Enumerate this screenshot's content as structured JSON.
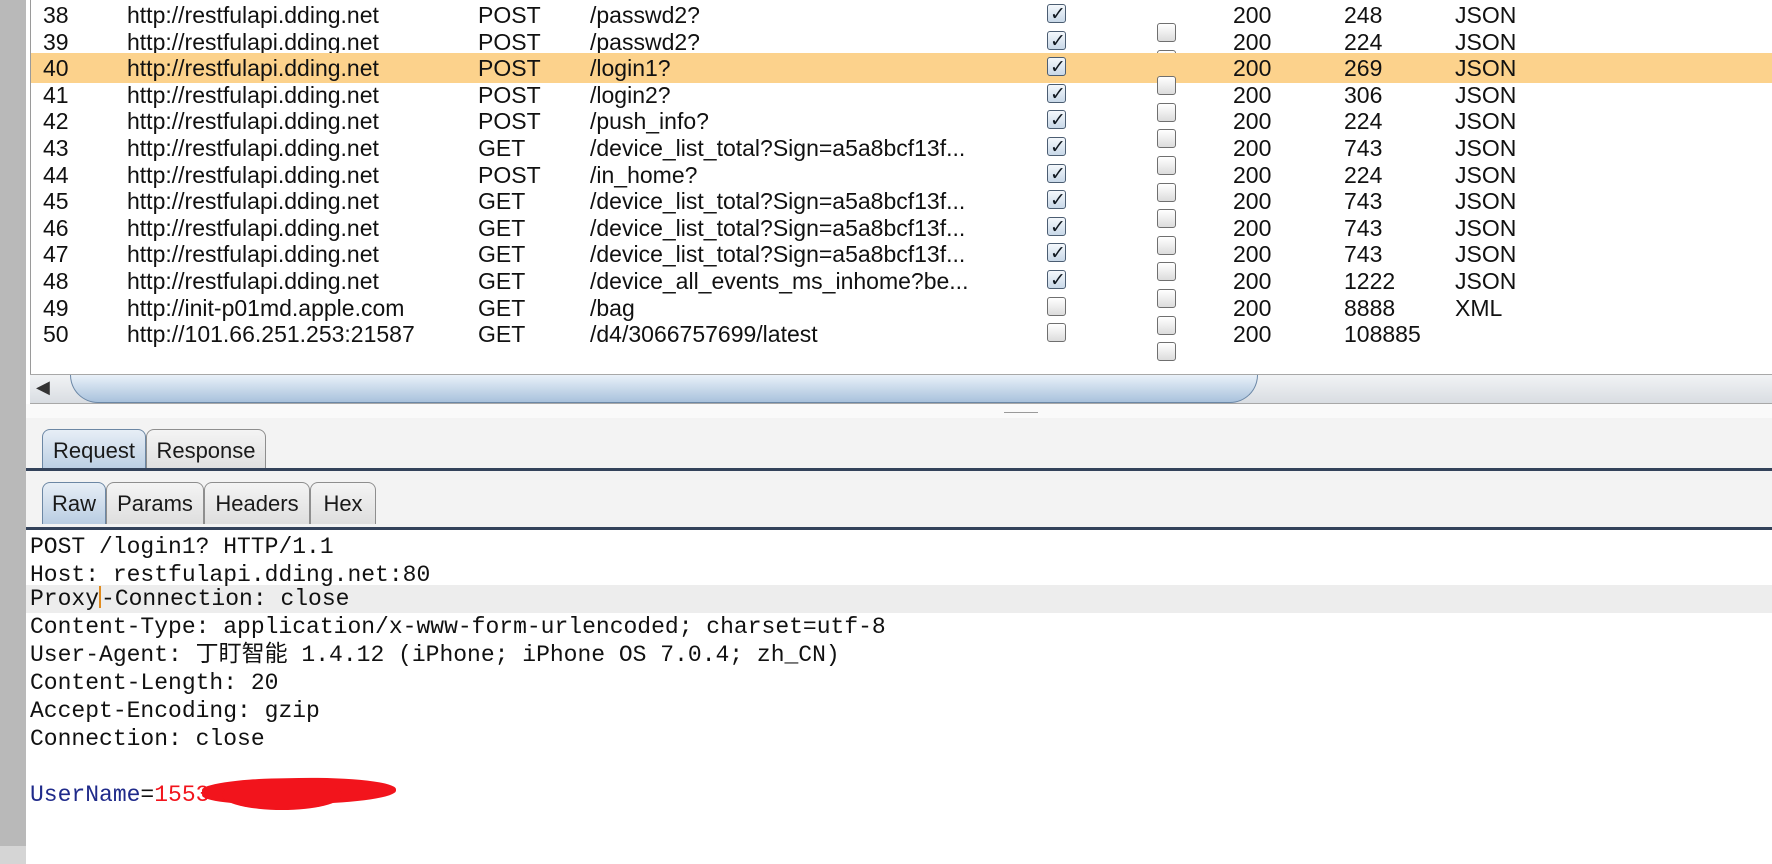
{
  "table": {
    "rows": [
      {
        "num": "38",
        "host": "http://restfulapi.dding.net",
        "method": "POST",
        "url": "/passwd2?",
        "params": true,
        "edited": false,
        "status": "200",
        "length": "248",
        "mime": "JSON",
        "selected": false
      },
      {
        "num": "39",
        "host": "http://restfulapi.dding.net",
        "method": "POST",
        "url": "/passwd2?",
        "params": true,
        "edited": false,
        "status": "200",
        "length": "224",
        "mime": "JSON",
        "selected": false
      },
      {
        "num": "40",
        "host": "http://restfulapi.dding.net",
        "method": "POST",
        "url": "/login1?",
        "params": true,
        "edited": false,
        "status": "200",
        "length": "269",
        "mime": "JSON",
        "selected": true
      },
      {
        "num": "41",
        "host": "http://restfulapi.dding.net",
        "method": "POST",
        "url": "/login2?",
        "params": true,
        "edited": false,
        "status": "200",
        "length": "306",
        "mime": "JSON",
        "selected": false
      },
      {
        "num": "42",
        "host": "http://restfulapi.dding.net",
        "method": "POST",
        "url": "/push_info?",
        "params": true,
        "edited": false,
        "status": "200",
        "length": "224",
        "mime": "JSON",
        "selected": false
      },
      {
        "num": "43",
        "host": "http://restfulapi.dding.net",
        "method": "GET",
        "url": "/device_list_total?Sign=a5a8bcf13f...",
        "params": true,
        "edited": false,
        "status": "200",
        "length": "743",
        "mime": "JSON",
        "selected": false
      },
      {
        "num": "44",
        "host": "http://restfulapi.dding.net",
        "method": "POST",
        "url": "/in_home?",
        "params": true,
        "edited": false,
        "status": "200",
        "length": "224",
        "mime": "JSON",
        "selected": false
      },
      {
        "num": "45",
        "host": "http://restfulapi.dding.net",
        "method": "GET",
        "url": "/device_list_total?Sign=a5a8bcf13f...",
        "params": true,
        "edited": false,
        "status": "200",
        "length": "743",
        "mime": "JSON",
        "selected": false
      },
      {
        "num": "46",
        "host": "http://restfulapi.dding.net",
        "method": "GET",
        "url": "/device_list_total?Sign=a5a8bcf13f...",
        "params": true,
        "edited": false,
        "status": "200",
        "length": "743",
        "mime": "JSON",
        "selected": false
      },
      {
        "num": "47",
        "host": "http://restfulapi.dding.net",
        "method": "GET",
        "url": "/device_list_total?Sign=a5a8bcf13f...",
        "params": true,
        "edited": false,
        "status": "200",
        "length": "743",
        "mime": "JSON",
        "selected": false
      },
      {
        "num": "48",
        "host": "http://restfulapi.dding.net",
        "method": "GET",
        "url": "/device_all_events_ms_inhome?be...",
        "params": true,
        "edited": false,
        "status": "200",
        "length": "1222",
        "mime": "JSON",
        "selected": false
      },
      {
        "num": "49",
        "host": "http://init-p01md.apple.com",
        "method": "GET",
        "url": "/bag",
        "params": false,
        "edited": false,
        "status": "200",
        "length": "8888",
        "mime": "XML",
        "selected": false
      },
      {
        "num": "50",
        "host": "http://101.66.251.253:21587",
        "method": "GET",
        "url": "/d4/3066757699/latest",
        "params": false,
        "edited": false,
        "status": "200",
        "length": "108885",
        "mime": "",
        "selected": false
      }
    ]
  },
  "tabs": {
    "request": "Request",
    "response": "Response"
  },
  "subtabs": {
    "raw": "Raw",
    "params": "Params",
    "headers": "Headers",
    "hex": "Hex"
  },
  "request_body": {
    "line1": "POST /login1? HTTP/1.1",
    "line2": "Host: restfulapi.dding.net:80",
    "line3_a": "Proxy",
    "line3_b": "-Connection: close",
    "line4": "Content-Type: application/x-www-form-urlencoded; charset=utf-8",
    "line5": "User-Agent: 丁盯智能 1.4.12 (iPhone; iPhone OS 7.0.4; zh_CN)",
    "line6": "Content-Length: 20",
    "line7": "Accept-Encoding: gzip",
    "line8": "Connection: close",
    "param_key": "UserName",
    "param_eq": "=",
    "param_value_visible": "1553"
  }
}
